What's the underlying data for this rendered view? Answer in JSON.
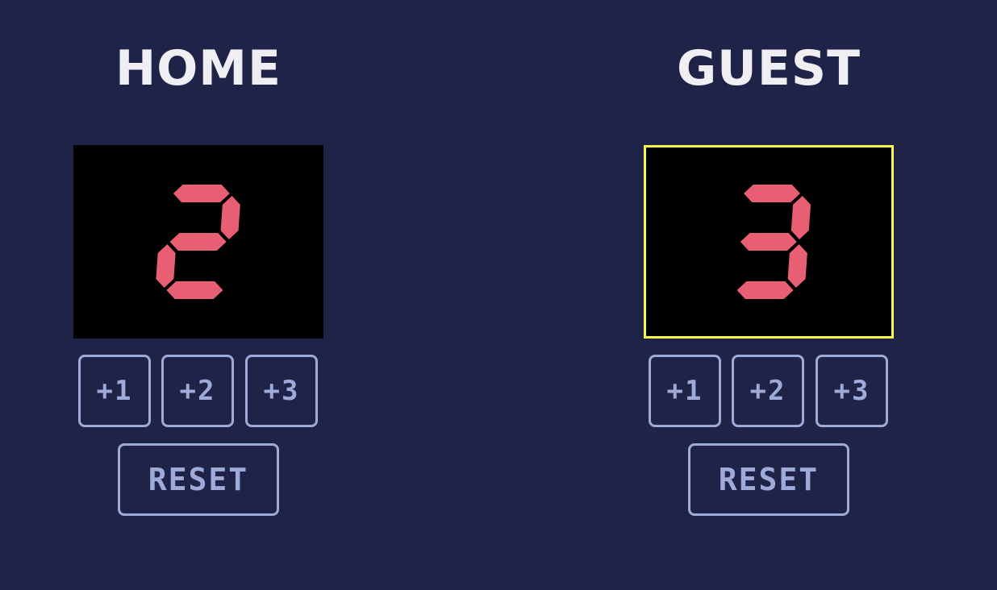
{
  "home": {
    "title": "HOME",
    "score": 2,
    "buttons": {
      "add1": "+1",
      "add2": "+2",
      "add3": "+3",
      "reset": "RESET"
    }
  },
  "guest": {
    "title": "GUEST",
    "score": 3,
    "highlighted": true,
    "buttons": {
      "add1": "+1",
      "add2": "+2",
      "add3": "+3",
      "reset": "RESET"
    }
  },
  "colors": {
    "background": "#1f2348",
    "title": "#eeeef3",
    "segment_on": "#e85e72",
    "button": "#9eaad8",
    "highlight": "#fafa45"
  }
}
